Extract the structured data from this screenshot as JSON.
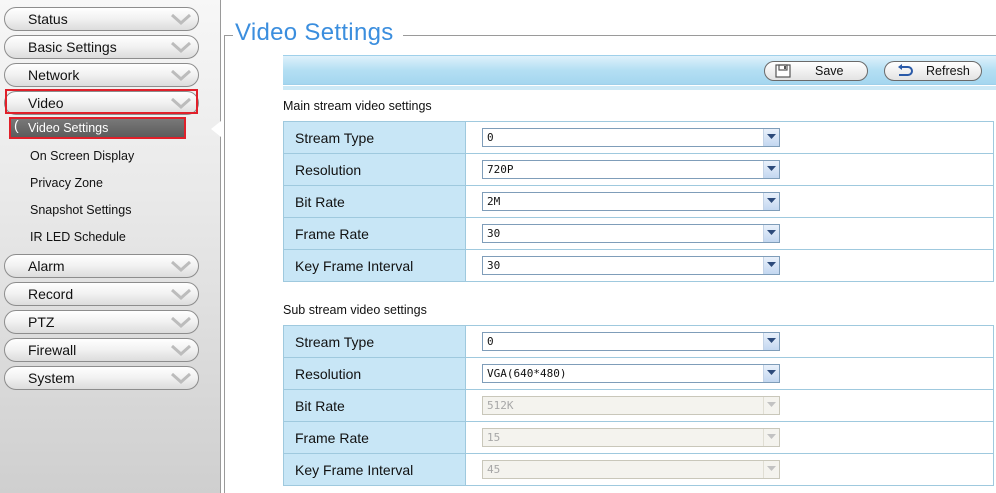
{
  "sidebar": {
    "items": [
      {
        "label": "Status"
      },
      {
        "label": "Basic Settings"
      },
      {
        "label": "Network"
      },
      {
        "label": "Video"
      },
      {
        "label": "Alarm"
      },
      {
        "label": "Record"
      },
      {
        "label": "PTZ"
      },
      {
        "label": "Firewall"
      },
      {
        "label": "System"
      }
    ],
    "video_subitems": [
      {
        "label": "Video Settings"
      },
      {
        "label": "On Screen Display"
      },
      {
        "label": "Privacy Zone"
      },
      {
        "label": "Snapshot Settings"
      },
      {
        "label": "IR LED Schedule"
      }
    ],
    "highlight_color": "#e0202a"
  },
  "page": {
    "title": "Video Settings",
    "title_color": "#3b8ede"
  },
  "toolbar": {
    "save_label": "Save",
    "refresh_label": "Refresh"
  },
  "main_stream": {
    "title": "Main stream video settings",
    "rows": [
      {
        "label": "Stream Type",
        "value": "0",
        "enabled": true
      },
      {
        "label": "Resolution",
        "value": "720P",
        "enabled": true
      },
      {
        "label": "Bit Rate",
        "value": "2M",
        "enabled": true
      },
      {
        "label": "Frame Rate",
        "value": "30",
        "enabled": true
      },
      {
        "label": "Key Frame Interval",
        "value": "30",
        "enabled": true
      }
    ]
  },
  "sub_stream": {
    "title": "Sub stream video settings",
    "rows": [
      {
        "label": "Stream Type",
        "value": "0",
        "enabled": true
      },
      {
        "label": "Resolution",
        "value": "VGA(640*480)",
        "enabled": true
      },
      {
        "label": "Bit Rate",
        "value": "512K",
        "enabled": false
      },
      {
        "label": "Frame Rate",
        "value": "15",
        "enabled": false
      },
      {
        "label": "Key Frame Interval",
        "value": "45",
        "enabled": false
      }
    ]
  },
  "icons": {
    "save": "floppy-disk-icon",
    "refresh": "undo-arrow-icon",
    "nav_chevron": "chevron-down-icon",
    "select_arrow": "dropdown-arrow-icon"
  }
}
